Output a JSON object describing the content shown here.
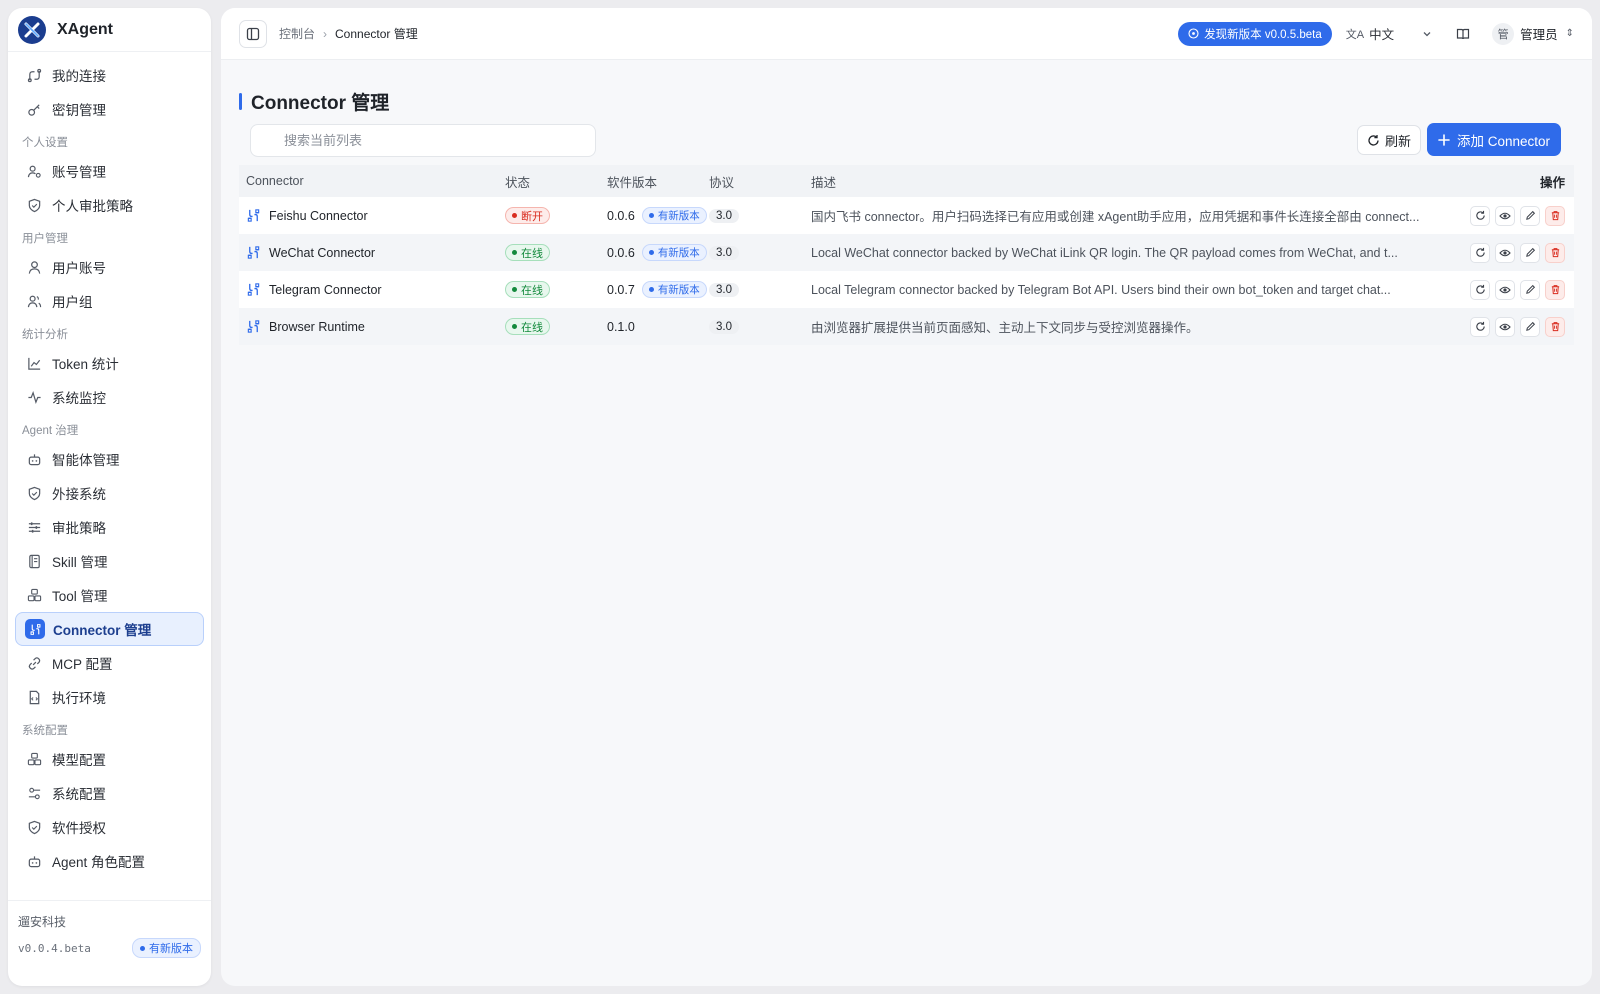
{
  "app": {
    "name": "XAgent"
  },
  "sidebar": {
    "top_items": [
      {
        "label": "我的连接",
        "icon": "connection-icon"
      },
      {
        "label": "密钥管理",
        "icon": "key-icon"
      }
    ],
    "groups": [
      {
        "title": "个人设置",
        "items": [
          {
            "label": "账号管理",
            "icon": "user-settings-icon"
          },
          {
            "label": "个人审批策略",
            "icon": "shield-icon"
          }
        ]
      },
      {
        "title": "用户管理",
        "items": [
          {
            "label": "用户账号",
            "icon": "user-icon"
          },
          {
            "label": "用户组",
            "icon": "users-icon"
          }
        ]
      },
      {
        "title": "统计分析",
        "items": [
          {
            "label": "Token 统计",
            "icon": "line-chart-icon"
          },
          {
            "label": "系统监控",
            "icon": "activity-icon"
          }
        ]
      },
      {
        "title": "Agent 治理",
        "items": [
          {
            "label": "智能体管理",
            "icon": "bot-icon"
          },
          {
            "label": "外接系统",
            "icon": "shield-icon"
          },
          {
            "label": "审批策略",
            "icon": "sliders-icon"
          },
          {
            "label": "Skill 管理",
            "icon": "book-icon"
          },
          {
            "label": "Tool 管理",
            "icon": "boxes-icon"
          },
          {
            "label": "Connector 管理",
            "icon": "connector-icon",
            "active": true
          },
          {
            "label": "MCP 配置",
            "icon": "link-icon"
          },
          {
            "label": "执行环境",
            "icon": "file-code-icon"
          }
        ]
      },
      {
        "title": "系统配置",
        "items": [
          {
            "label": "模型配置",
            "icon": "boxes-icon"
          },
          {
            "label": "系统配置",
            "icon": "settings-sliders-icon"
          },
          {
            "label": "软件授权",
            "icon": "shield-icon"
          },
          {
            "label": "Agent 角色配置",
            "icon": "bot-icon"
          }
        ]
      }
    ],
    "footer": {
      "company": "遛安科技",
      "version": "v0.0.4.beta",
      "badge": "有新版本"
    }
  },
  "topbar": {
    "breadcrumb": [
      "控制台",
      "Connector 管理"
    ],
    "update_label": "发现新版本 v0.0.5.beta",
    "language": "中文",
    "user_avatar": "管",
    "user_name": "管理员"
  },
  "page": {
    "title": "Connector 管理",
    "search_placeholder": "搜索当前列表",
    "refresh_label": "刷新",
    "add_label": "添加 Connector"
  },
  "table": {
    "columns": [
      "Connector",
      "状态",
      "软件版本",
      "协议",
      "描述",
      "操作"
    ],
    "new_version_label": "有新版本",
    "rows": [
      {
        "name": "Feishu Connector",
        "status": "断开",
        "status_type": "off",
        "version": "0.0.6",
        "has_new": true,
        "protocol": "3.0",
        "desc": "国内飞书 connector。用户扫码选择已有应用或创建 xAgent助手应用，应用凭据和事件长连接全部由 connect..."
      },
      {
        "name": "WeChat Connector",
        "status": "在线",
        "status_type": "on",
        "version": "0.0.6",
        "has_new": true,
        "protocol": "3.0",
        "desc": "Local WeChat connector backed by WeChat iLink QR login. The QR payload comes from WeChat, and t..."
      },
      {
        "name": "Telegram Connector",
        "status": "在线",
        "status_type": "on",
        "version": "0.0.7",
        "has_new": true,
        "protocol": "3.0",
        "desc": "Local Telegram connector backed by Telegram Bot API. Users bind their own bot_token and target chat..."
      },
      {
        "name": "Browser Runtime",
        "status": "在线",
        "status_type": "on",
        "version": "0.1.0",
        "has_new": false,
        "protocol": "3.0",
        "desc": "由浏览器扩展提供当前页面感知、主动上下文同步与受控浏览器操作。"
      }
    ],
    "row_actions": [
      "refresh-icon",
      "eye-icon",
      "edit-icon",
      "delete-icon"
    ]
  },
  "colors": {
    "accent": "#2f6bea",
    "danger": "#d92d20",
    "success": "#138a3c"
  }
}
